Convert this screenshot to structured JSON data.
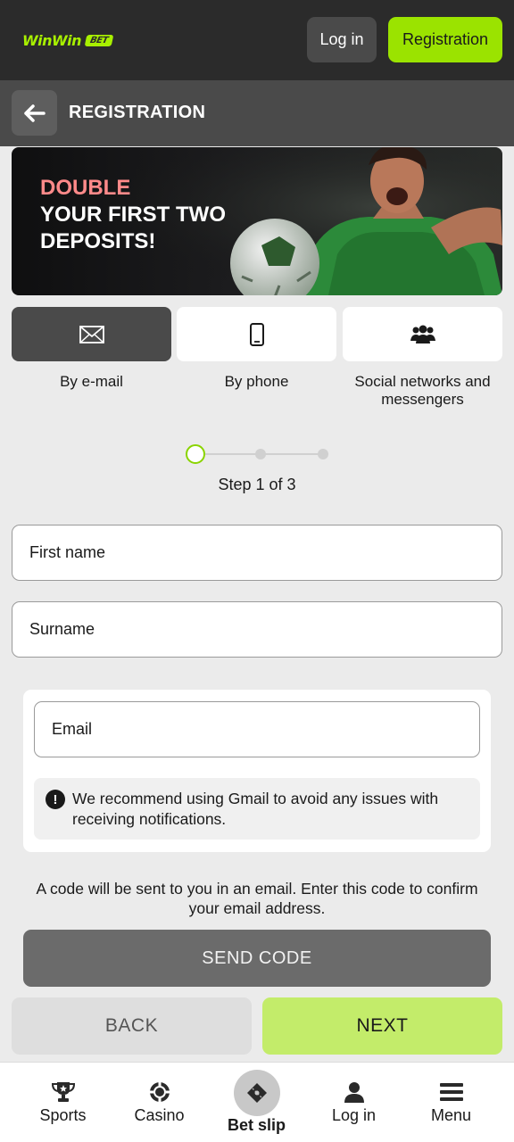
{
  "header": {
    "logo_text": "WinWin",
    "logo_badge": "BET",
    "login_label": "Log in",
    "register_label": "Registration"
  },
  "subheader": {
    "title": "REGISTRATION"
  },
  "banner": {
    "highlight": "DOUBLE",
    "line2": "YOUR FIRST TWO",
    "line3": "DEPOSITS!"
  },
  "methods": [
    {
      "label": "By e-mail",
      "icon": "envelope-icon",
      "active": true
    },
    {
      "label": "By phone",
      "icon": "phone-icon",
      "active": false
    },
    {
      "label": "Social networks and messengers",
      "icon": "users-icon",
      "active": false
    }
  ],
  "stepper": {
    "text": "Step 1 of 3",
    "current": 1,
    "total": 3
  },
  "form": {
    "first_name_placeholder": "First name",
    "surname_placeholder": "Surname",
    "email_placeholder": "Email",
    "notice": "We recommend using Gmail to avoid any issues with receiving notifications.",
    "code_info": "A code will be sent to you in an email. Enter this code to confirm your email address.",
    "send_code_label": "SEND CODE",
    "back_label": "BACK",
    "next_label": "NEXT"
  },
  "bottom_nav": [
    {
      "label": "Sports",
      "icon": "trophy-icon"
    },
    {
      "label": "Casino",
      "icon": "casino-chip-icon"
    },
    {
      "label": "Bet slip",
      "icon": "ticket-icon"
    },
    {
      "label": "Log in",
      "icon": "user-icon"
    },
    {
      "label": "Menu",
      "icon": "hamburger-icon"
    }
  ],
  "colors": {
    "accent_green": "#9be300",
    "header_bg": "#2b2b2b",
    "subheader_bg": "#4a4a4a",
    "next_bg": "#c3ec6a",
    "send_code_bg": "#6b6b6b"
  }
}
